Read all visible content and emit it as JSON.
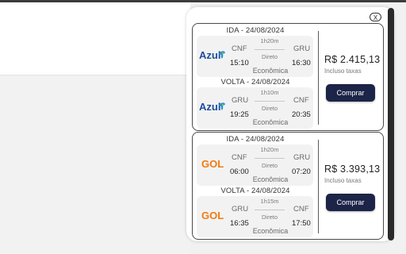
{
  "close_label": "X",
  "colors": {
    "buy_button": "#1c2447",
    "azul_brand": "#1b4d9b",
    "gol_brand": "#f07b12"
  },
  "offers": [
    {
      "price": "R$ 2.415,13",
      "tax_note": "Incluso taxas",
      "buy_label": "Comprar",
      "legs": [
        {
          "title": "IDA - 24/08/2024",
          "airline": "Azul",
          "logo_icon": "azul-logo-icon",
          "from": "CNF",
          "to": "GRU",
          "depart": "15:10",
          "arrive": "16:30",
          "duration": "1h20m",
          "stops": "Direto",
          "cabin": "Econômica"
        },
        {
          "title": "VOLTA - 24/08/2024",
          "airline": "Azul",
          "logo_icon": "azul-logo-icon",
          "from": "GRU",
          "to": "CNF",
          "depart": "19:25",
          "arrive": "20:35",
          "duration": "1h10m",
          "stops": "Direto",
          "cabin": "Econômica"
        }
      ]
    },
    {
      "price": "R$ 3.393,13",
      "tax_note": "Incluso taxas",
      "buy_label": "Comprar",
      "legs": [
        {
          "title": "IDA - 24/08/2024",
          "airline": "GOL",
          "logo_icon": "gol-logo-icon",
          "from": "CNF",
          "to": "GRU",
          "depart": "06:00",
          "arrive": "07:20",
          "duration": "1h20m",
          "stops": "Direto",
          "cabin": "Econômica"
        },
        {
          "title": "VOLTA - 24/08/2024",
          "airline": "GOL",
          "logo_icon": "gol-logo-icon",
          "from": "GRU",
          "to": "CNF",
          "depart": "16:35",
          "arrive": "17:50",
          "duration": "1h15m",
          "stops": "Direto",
          "cabin": "Econômica"
        }
      ]
    }
  ]
}
